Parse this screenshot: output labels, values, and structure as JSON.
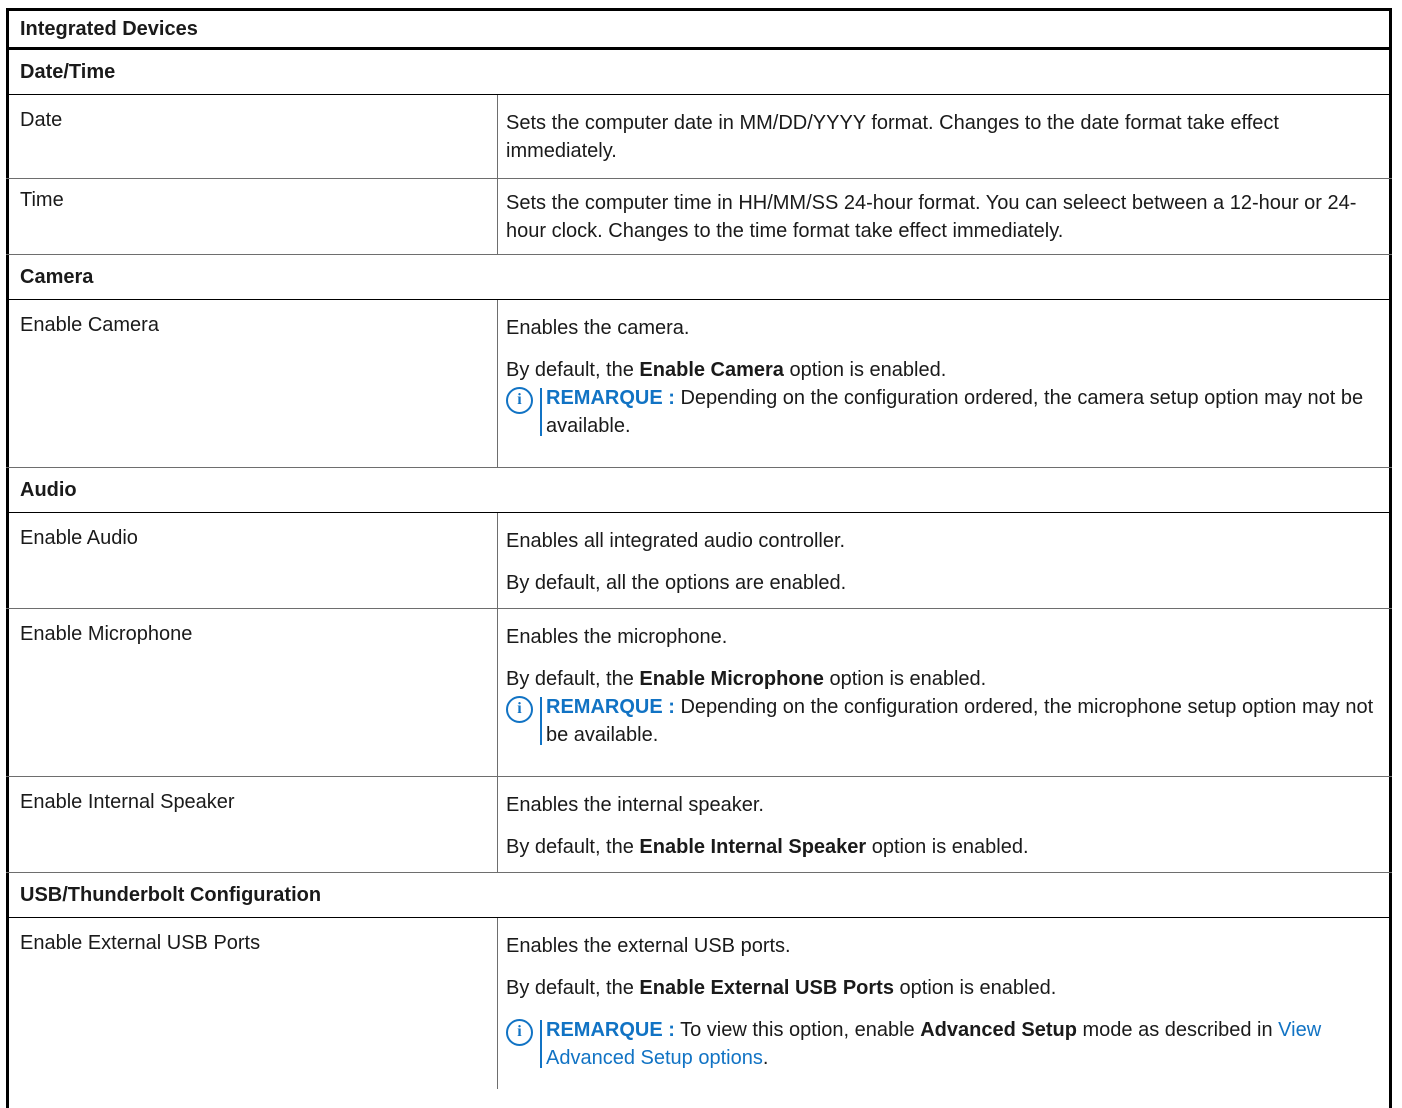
{
  "table_title": "Integrated Devices",
  "sections": {
    "datetime": "Date/Time",
    "camera": "Camera",
    "audio": "Audio",
    "usb": "USB/Thunderbolt Configuration"
  },
  "rows": {
    "date": {
      "label": "Date",
      "desc": "Sets the computer date in MM/DD/YYYY format. Changes to the date format take effect immediately."
    },
    "time": {
      "label": "Time",
      "desc": "Sets the computer time in HH/MM/SS 24-hour format. You can seleect between a 12-hour or 24-hour clock. Changes to the time format take effect immediately."
    },
    "camera": {
      "label": "Enable Camera",
      "desc1": "Enables the camera.",
      "default_pre": "By default, the ",
      "default_bold": "Enable Camera",
      "default_post": " option is enabled.",
      "note_tag": "REMARQUE :",
      "note_text": " Depending on the configuration ordered, the camera setup option may not be available."
    },
    "audio": {
      "label": "Enable Audio",
      "desc1": "Enables all integrated audio controller.",
      "desc2": "By default, all the options are enabled."
    },
    "microphone": {
      "label": "Enable Microphone",
      "desc1": "Enables the microphone.",
      "default_pre": "By default, the ",
      "default_bold": "Enable Microphone",
      "default_post": " option is enabled.",
      "note_tag": "REMARQUE :",
      "note_text": " Depending on the configuration ordered, the microphone setup option may not be available."
    },
    "speaker": {
      "label": "Enable Internal Speaker",
      "desc1": "Enables the internal speaker.",
      "default_pre": "By default, the ",
      "default_bold": "Enable Internal Speaker",
      "default_post": " option is enabled."
    },
    "usb_ports": {
      "label": "Enable External USB Ports",
      "desc1": "Enables the external USB ports.",
      "default_pre": "By default, the ",
      "default_bold": "Enable External USB Ports",
      "default_post": " option is enabled.",
      "note_tag": "REMARQUE :",
      "note_pre": " To view this option, enable ",
      "note_bold": "Advanced Setup",
      "note_mid": " mode as described in ",
      "note_link": "View Advanced Setup options",
      "note_end": "."
    }
  },
  "icons": {
    "note": "info-icon",
    "note_glyph": "i"
  },
  "colors": {
    "accent": "#1173c4",
    "border": "#000000"
  }
}
